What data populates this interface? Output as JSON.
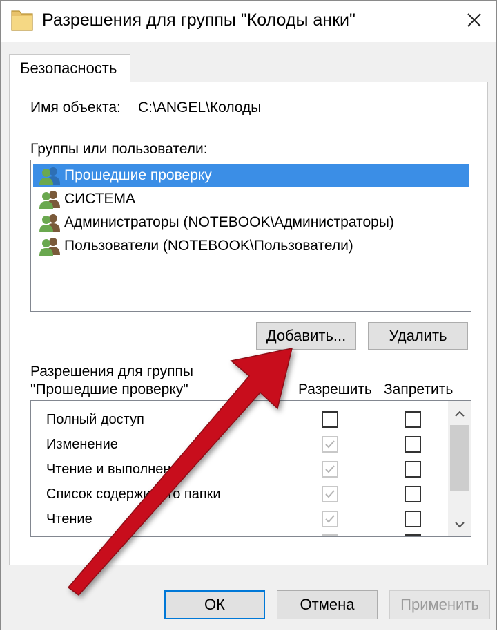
{
  "window": {
    "title": "Разрешения для группы \"Колоды анки\"",
    "icons": {
      "title": "folder-icon",
      "close": "close-icon"
    }
  },
  "tabs": [
    {
      "label": "Безопасность",
      "selected": true
    }
  ],
  "object": {
    "label": "Имя объекта:",
    "value": "C:\\ANGEL\\Колоды"
  },
  "groups": {
    "label": "Группы или пользователи:",
    "items": [
      {
        "name": "Прошедшие проверку",
        "selected": true,
        "icon": "users-icon"
      },
      {
        "name": "СИСТЕМА",
        "selected": false,
        "icon": "users-icon"
      },
      {
        "name": "Администраторы (NOTEBOOK\\Администраторы)",
        "selected": false,
        "icon": "users-icon"
      },
      {
        "name": "Пользователи (NOTEBOOK\\Пользователи)",
        "selected": false,
        "icon": "users-icon"
      }
    ]
  },
  "buttons": {
    "add": "Добавить...",
    "remove": "Удалить",
    "ok": "ОК",
    "cancel": "Отмена",
    "apply": "Применить"
  },
  "permissions": {
    "header_line1": "Разрешения для группы",
    "header_line2": "\"Прошедшие проверку\"",
    "allow_label": "Разрешить",
    "deny_label": "Запретить",
    "rows": [
      {
        "name": "Полный доступ",
        "allow": false,
        "allow_disabled": false,
        "deny": false
      },
      {
        "name": "Изменение",
        "allow": true,
        "allow_disabled": true,
        "deny": false
      },
      {
        "name": "Чтение и выполнение",
        "allow": true,
        "allow_disabled": true,
        "deny": false
      },
      {
        "name": "Список содержимого папки",
        "allow": true,
        "allow_disabled": true,
        "deny": false
      },
      {
        "name": "Чтение",
        "allow": true,
        "allow_disabled": true,
        "deny": false
      }
    ]
  },
  "annotation": {
    "type": "arrow",
    "color": "#c8101e",
    "points_to": "add-button"
  }
}
